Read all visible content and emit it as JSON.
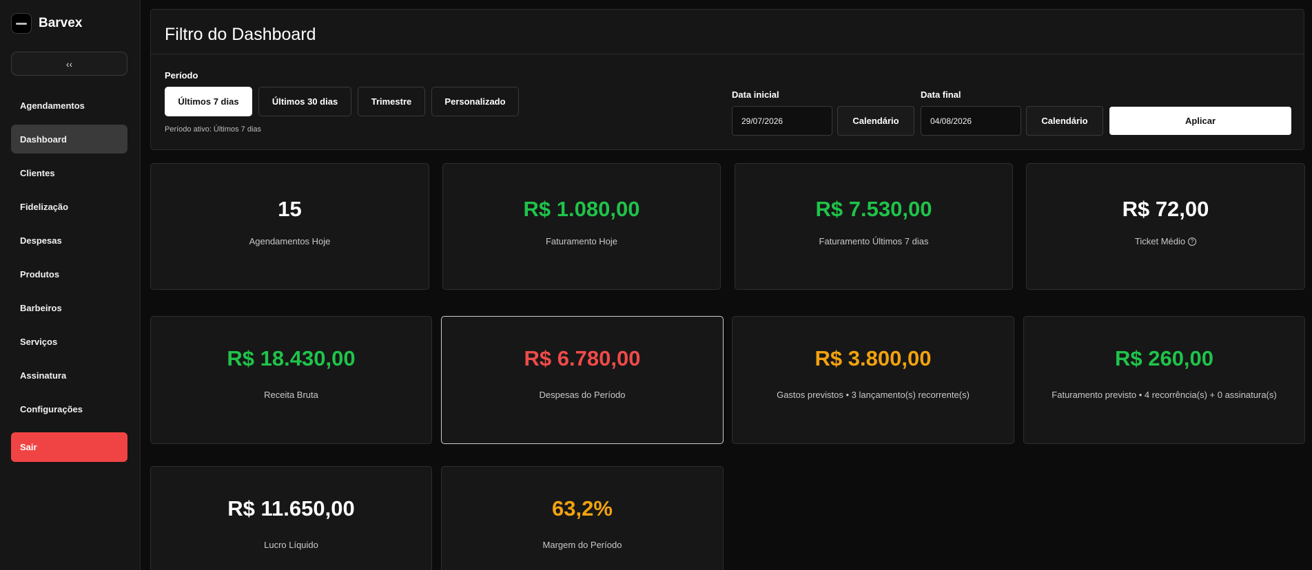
{
  "app": {
    "name": "Barvex"
  },
  "sidebar": {
    "collapse_label": "‹‹",
    "items": [
      {
        "label": "Agendamentos",
        "active": false
      },
      {
        "label": "Dashboard",
        "active": true
      },
      {
        "label": "Clientes",
        "active": false
      },
      {
        "label": "Fidelização",
        "active": false
      },
      {
        "label": "Despesas",
        "active": false
      },
      {
        "label": "Produtos",
        "active": false
      },
      {
        "label": "Barbeiros",
        "active": false
      },
      {
        "label": "Serviços",
        "active": false
      },
      {
        "label": "Assinatura",
        "active": false
      },
      {
        "label": "Configurações",
        "active": false
      }
    ],
    "logout_label": "Sair"
  },
  "filter": {
    "title": "Filtro do Dashboard",
    "period_label": "Período",
    "period_options": [
      "Últimos 7 dias",
      "Últimos 30 dias",
      "Trimestre",
      "Personalizado"
    ],
    "selected_period": "Últimos 7 dias",
    "active_period_text": "Período ativo: Últimos 7 dias",
    "start_date_label": "Data inicial",
    "start_date_value": "29/07/2026",
    "end_date_label": "Data final",
    "end_date_value": "04/08/2026",
    "calendar_label": "Calendário",
    "apply_label": "Aplicar"
  },
  "cards": [
    {
      "value": "15",
      "label": "Agendamentos Hoje",
      "color": "#ffffff"
    },
    {
      "value": "R$ 1.080,00",
      "label": "Faturamento Hoje",
      "color": "#1fc34a"
    },
    {
      "value": "R$ 7.530,00",
      "label": "Faturamento Últimos 7 dias",
      "color": "#1fc34a"
    },
    {
      "value": "R$ 72,00",
      "label": "Ticket Médio",
      "color": "#ffffff",
      "icon": "info-icon"
    },
    {
      "value": "R$ 18.430,00",
      "label": "Receita Bruta",
      "color": "#1fc34a"
    },
    {
      "value": "R$ 6.780,00",
      "label": "Despesas do Período",
      "color": "#f04a4a"
    },
    {
      "value": "R$ 3.800,00",
      "label": "Gastos previstos • 3 lançamento(s) recorrente(s)",
      "color": "#f2a20f"
    },
    {
      "value": "R$ 260,00",
      "label": "Faturamento previsto • 4 recorrência(s) + 0 assinatura(s)",
      "color": "#1fc34a"
    },
    {
      "value": "R$ 11.650,00",
      "label": "Lucro Líquido",
      "color": "#ffffff"
    },
    {
      "value": "63,2%",
      "label": "Margem do Período",
      "color": "#f2a20f"
    }
  ]
}
